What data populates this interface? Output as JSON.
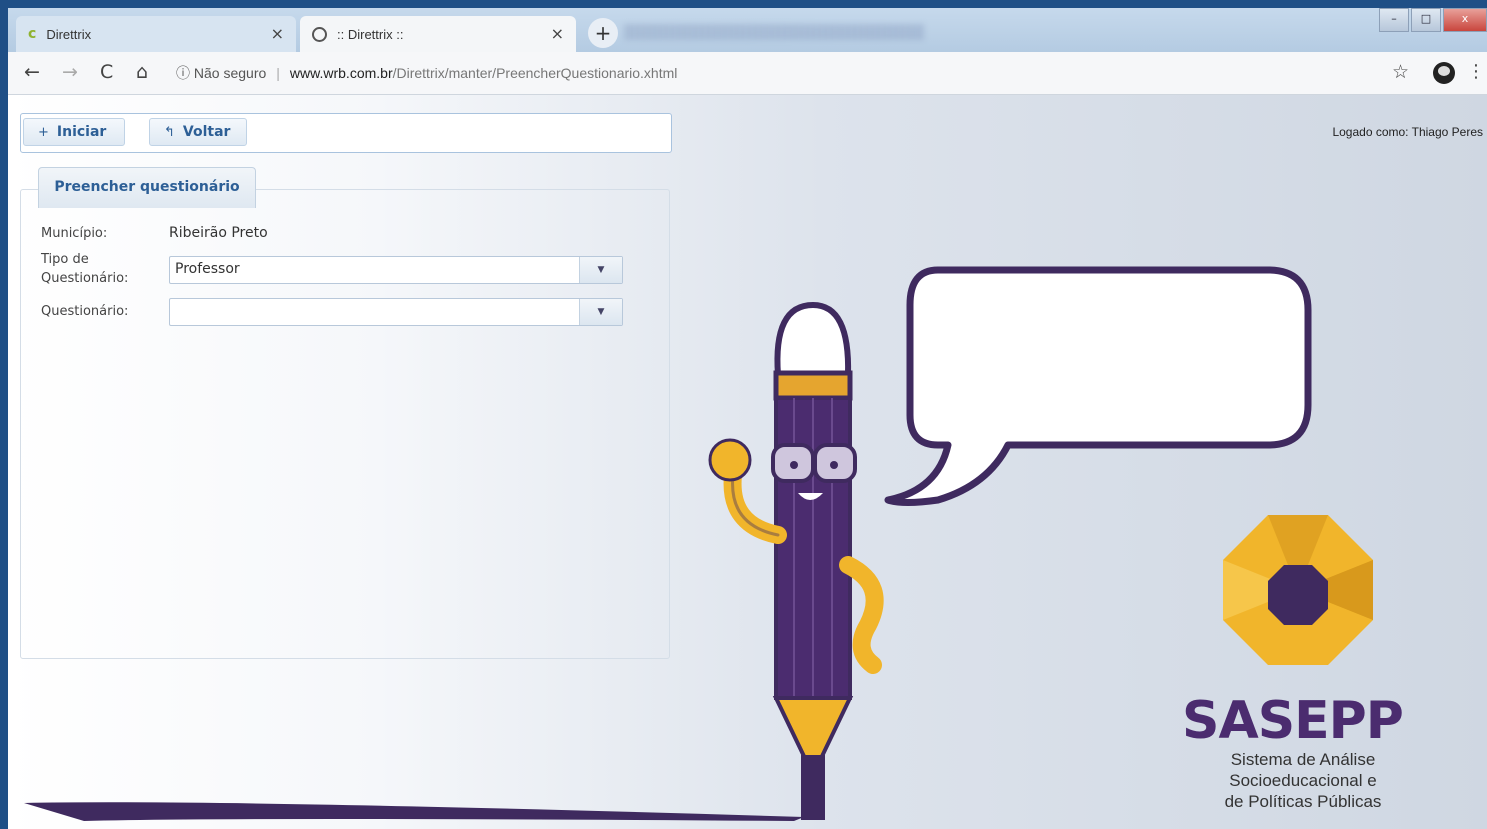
{
  "browser": {
    "tabs": [
      {
        "title": "Direttrix",
        "close": "×",
        "active": false
      },
      {
        "title": ":: Direttrix ::",
        "close": "×",
        "active": true
      }
    ],
    "new_tab": "+",
    "nav": {
      "back": "←",
      "forward": "→",
      "reload": "C",
      "home": "⌂"
    },
    "security": "ⓘ Não seguro",
    "url_host": "www.wrb.com.br",
    "url_path": "/Direttrix/manter/PreencherQuestionario.xhtml",
    "star": "☆",
    "menu": "⋮"
  },
  "toolbar": {
    "iniciar_icon": "+",
    "iniciar_label": "Iniciar",
    "voltar_icon": "↰",
    "voltar_label": "Voltar"
  },
  "logged_in": "Logado como: Thiago Peres",
  "panel": {
    "tab_label": "Preencher questionário",
    "municipio_label": "Município:",
    "municipio_value": "Ribeirão Preto",
    "tipo_label_line1": "Tipo de",
    "tipo_label_line2": "Questionário:",
    "tipo_value": "Professor",
    "questionario_label": "Questionário:",
    "questionario_value": ""
  },
  "branding": {
    "name": "SASEPP",
    "line1": "Sistema de Análise",
    "line2": "Socioeducacional e",
    "line3": "de Políticas Públicas"
  },
  "colors": {
    "frame": "#1f4f86",
    "accent": "#2d5f96",
    "purple": "#4b2c6f",
    "gold": "#f1b52b"
  }
}
